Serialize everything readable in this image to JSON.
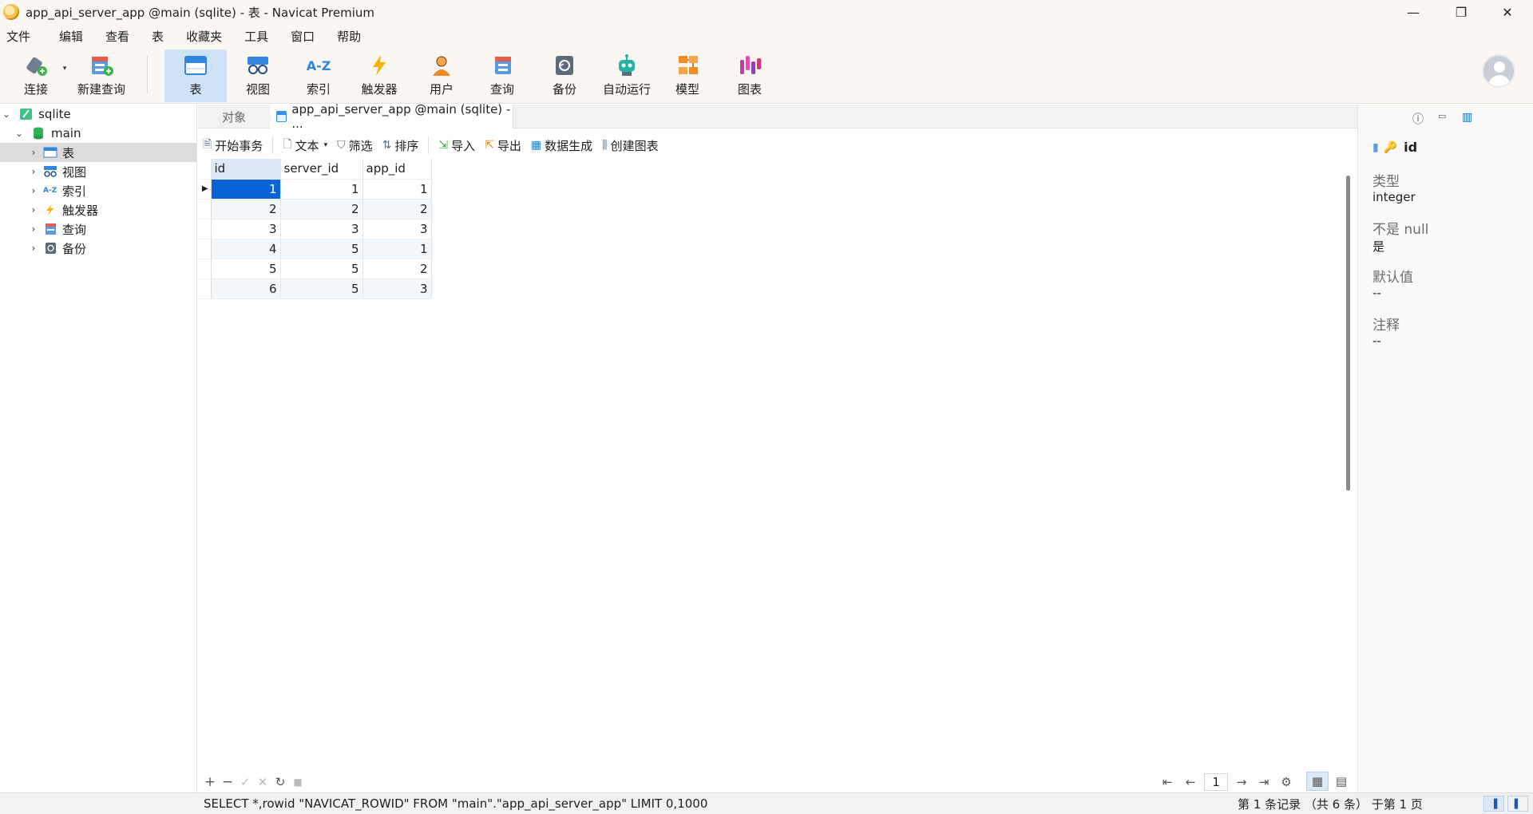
{
  "window": {
    "title": "app_api_server_app @main (sqlite) - 表 - Navicat Premium",
    "controls": [
      "—",
      "❐",
      "✕"
    ]
  },
  "menu": [
    "文件",
    "编辑",
    "查看",
    "表",
    "收藏夹",
    "工具",
    "窗口",
    "帮助"
  ],
  "toolbar": {
    "connect": "连接",
    "new_query": "新建查询",
    "table": "表",
    "view": "视图",
    "index": "索引",
    "trigger": "触发器",
    "user": "用户",
    "query": "查询",
    "backup": "备份",
    "automation": "自动运行",
    "model": "模型",
    "chart": "图表",
    "index_icon_text": "A-Z",
    "active": "table"
  },
  "tree": {
    "root": "sqlite",
    "db": "main",
    "items": [
      "表",
      "视图",
      "索引",
      "触发器",
      "查询",
      "备份"
    ],
    "index_icon_text": "A-Z",
    "selected": "表"
  },
  "tabs": {
    "objects": "对象",
    "active": "app_api_server_app @main (sqlite) - ..."
  },
  "gridbar": {
    "begin_tx": "开始事务",
    "text": "文本",
    "filter": "筛选",
    "sort": "排序",
    "import": "导入",
    "export": "导出",
    "data_gen": "数据生成",
    "create_chart": "创建图表"
  },
  "table": {
    "columns": [
      "id",
      "server_id",
      "app_id"
    ],
    "rows": [
      [
        "1",
        "1",
        "1"
      ],
      [
        "2",
        "2",
        "2"
      ],
      [
        "3",
        "3",
        "3"
      ],
      [
        "4",
        "5",
        "1"
      ],
      [
        "5",
        "5",
        "2"
      ],
      [
        "6",
        "5",
        "3"
      ]
    ]
  },
  "right_panel": {
    "field_name": "id",
    "type_label": "类型",
    "type_value": "integer",
    "notnull_label": "不是 null",
    "notnull_value": "是",
    "default_label": "默认值",
    "default_value": "--",
    "comment_label": "注释",
    "comment_value": "--"
  },
  "bottom": {
    "page": "1"
  },
  "status": {
    "sql": "SELECT *,rowid \"NAVICAT_ROWID\" FROM \"main\".\"app_api_server_app\" LIMIT 0,1000",
    "records": "第 1 条记录 （共 6 条） 于第 1 页"
  },
  "colors": {
    "accent": "#0a64d6",
    "active_toolbar": "#cfe3f7",
    "chrome": "#faf6f1"
  }
}
